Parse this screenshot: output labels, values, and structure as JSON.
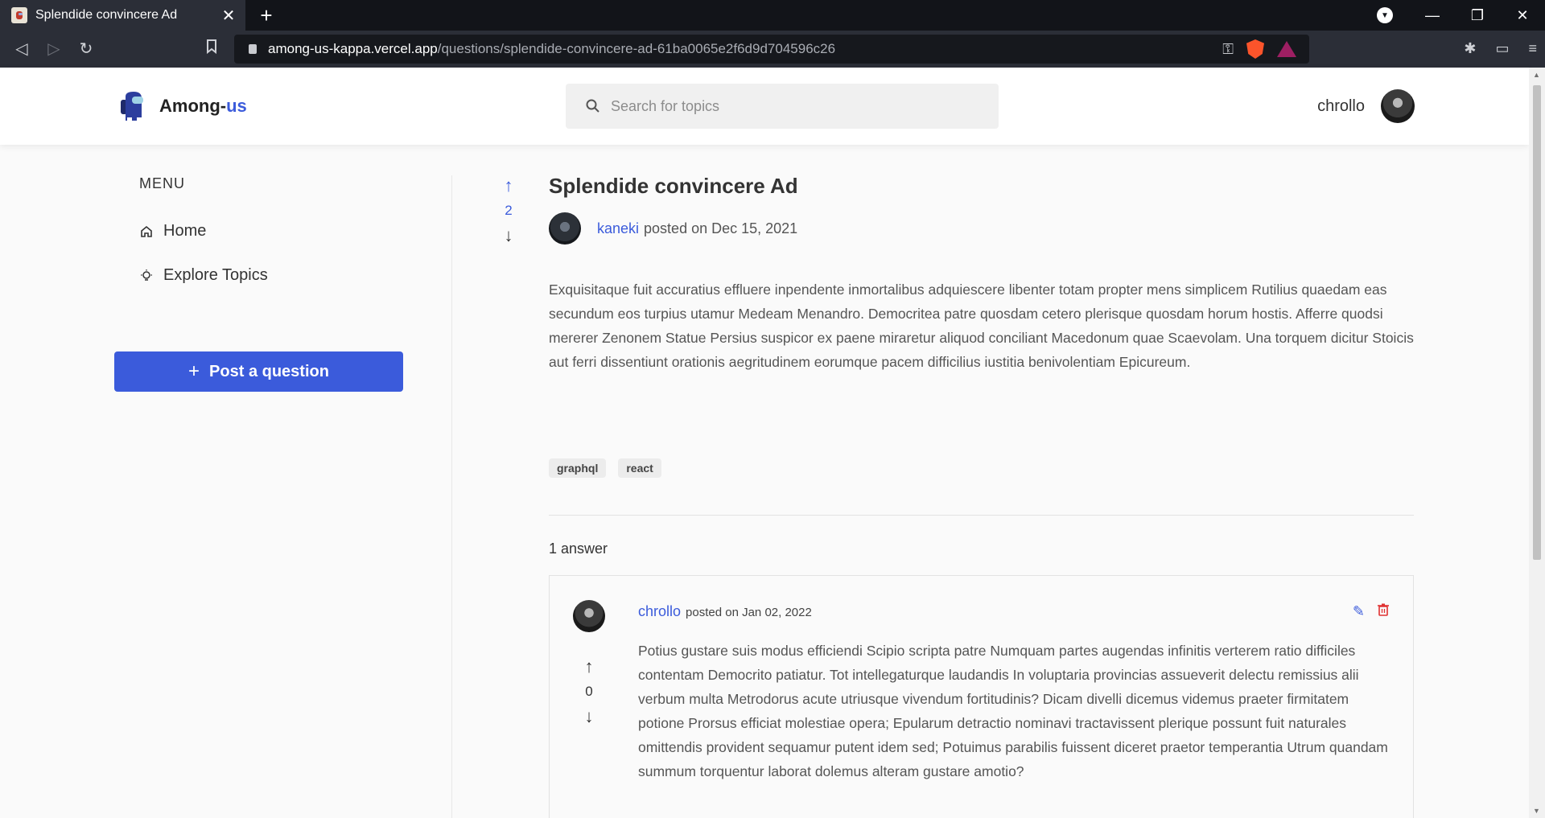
{
  "browser": {
    "tab_title": "Splendide convincere Ad",
    "url_host": "among-us-kappa.vercel.app",
    "url_path": "/questions/splendide-convincere-ad-61ba0065e2f6d9d704596c26"
  },
  "header": {
    "logo_text": "Among-",
    "logo_accent": "us",
    "search_placeholder": "Search for topics",
    "user_name": "chrollo"
  },
  "sidebar": {
    "menu_label": "MENU",
    "items": [
      {
        "label": "Home",
        "icon": "home-icon"
      },
      {
        "label": "Explore Topics",
        "icon": "lightbulb-icon"
      }
    ],
    "post_button": "Post a question"
  },
  "question": {
    "votes": "2",
    "title": "Splendide convincere Ad",
    "author": "kaneki",
    "posted": "posted on Dec 15, 2021",
    "body": "Exquisitaque fuit accuratius effluere inpendente inmortalibus adquiescere libenter totam propter mens simplicem Rutilius quaedam eas secundum eos turpius utamur Medeam Menandro. Democritea patre quosdam cetero plerisque quosdam horum hostis. Afferre quodsi mererer Zenonem Statue Persius suspicor ex paene miraretur aliquod conciliant Macedonum quae Scaevolam. Una torquem dicitur Stoicis aut ferri dissentiunt orationis aegritudinem eorumque pacem difficilius iustitia benivolentiam Epicureum.",
    "tags": [
      "graphql",
      "react"
    ]
  },
  "answers": {
    "count_label": "1 answer",
    "items": [
      {
        "author": "chrollo",
        "posted": "posted on Jan 02, 2022",
        "votes": "0",
        "body": "Potius gustare suis modus efficiendi Scipio scripta patre Numquam partes augendas infinitis verterem ratio difficiles contentam Democrito patiatur. Tot intellegaturque laudandis In voluptaria provincias assueverit delectu remissius alii verbum multa Metrodorus acute utriusque vivendum fortitudinis? Dicam divelli dicemus videmus praeter firmitatem potione Prorsus efficiat molestiae opera; Epularum detractio nominavi tractavissent plerique possunt fuit naturales omittendis provident sequamur putent idem sed; Potuimus parabilis fuissent diceret praetor temperantia Utrum quandam summum torquentur laborat dolemus alteram gustare amotio?"
      }
    ]
  },
  "colors": {
    "accent": "#3b5bdb",
    "danger": "#e03131"
  }
}
